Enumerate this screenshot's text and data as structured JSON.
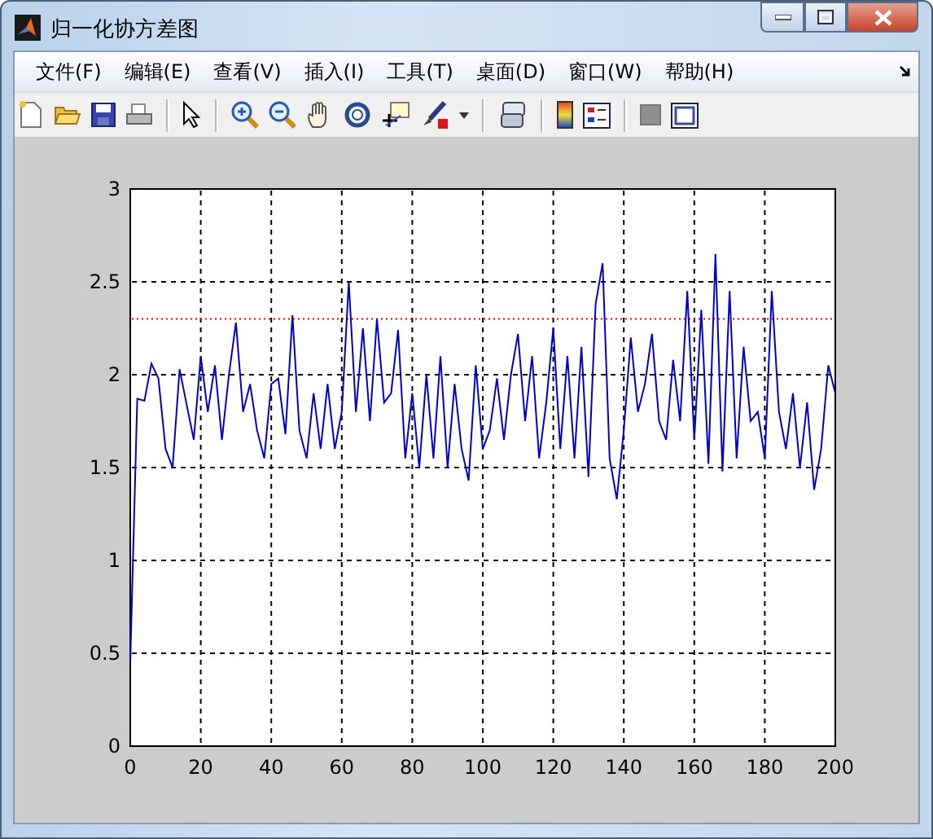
{
  "window": {
    "title": "归一化协方差图"
  },
  "menu": [
    "文件(F)",
    "编辑(E)",
    "查看(V)",
    "插入(I)",
    "工具(T)",
    "桌面(D)",
    "窗口(W)",
    "帮助(H)"
  ],
  "figure": {
    "chart_data": {
      "type": "line",
      "grid": true,
      "xlim": [
        0,
        200
      ],
      "ylim": [
        0,
        3
      ],
      "xticks": [
        0,
        20,
        40,
        60,
        80,
        100,
        120,
        140,
        160,
        180,
        200
      ],
      "yticks": [
        0,
        0.5,
        1,
        1.5,
        2,
        2.5,
        3
      ],
      "x": [
        0,
        2,
        4,
        6,
        8,
        10,
        12,
        14,
        16,
        18,
        20,
        22,
        24,
        26,
        28,
        30,
        32,
        34,
        36,
        38,
        40,
        42,
        44,
        46,
        48,
        50,
        52,
        54,
        56,
        58,
        60,
        62,
        64,
        66,
        68,
        70,
        72,
        74,
        76,
        78,
        80,
        82,
        84,
        86,
        88,
        90,
        92,
        94,
        96,
        98,
        100,
        102,
        104,
        106,
        108,
        110,
        112,
        114,
        116,
        118,
        120,
        122,
        124,
        126,
        128,
        130,
        132,
        134,
        136,
        138,
        140,
        142,
        144,
        146,
        148,
        150,
        152,
        154,
        156,
        158,
        160,
        162,
        164,
        166,
        168,
        170,
        172,
        174,
        176,
        178,
        180,
        182,
        184,
        186,
        188,
        190,
        192,
        194,
        196,
        198,
        200
      ],
      "series": [
        {
          "color": "#0000c8",
          "line_style": "solid",
          "values": [
            0.45,
            1.87,
            1.86,
            2.06,
            1.98,
            1.6,
            1.5,
            2.03,
            1.84,
            1.65,
            2.1,
            1.8,
            2.05,
            1.65,
            2.0,
            2.28,
            1.8,
            1.95,
            1.7,
            1.55,
            1.95,
            1.98,
            1.68,
            2.32,
            1.7,
            1.55,
            1.9,
            1.6,
            1.95,
            1.6,
            1.8,
            2.5,
            1.8,
            2.25,
            1.75,
            2.3,
            1.85,
            1.9,
            2.24,
            1.55,
            1.9,
            1.5,
            2.0,
            1.55,
            2.1,
            1.5,
            1.95,
            1.6,
            1.43,
            2.05,
            1.6,
            1.7,
            1.98,
            1.65,
            2.0,
            2.22,
            1.75,
            2.1,
            1.55,
            1.85,
            2.25,
            1.6,
            2.1,
            1.55,
            2.15,
            1.45,
            2.38,
            2.6,
            1.55,
            1.33,
            1.7,
            2.2,
            1.8,
            1.95,
            2.22,
            1.75,
            1.65,
            2.08,
            1.75,
            2.45,
            1.65,
            2.35,
            1.52,
            2.65,
            1.48,
            2.45,
            1.55,
            2.15,
            1.75,
            1.8,
            1.55,
            2.45,
            1.8,
            1.6,
            1.9,
            1.5,
            1.85,
            1.38,
            1.6,
            2.05,
            1.9
          ]
        }
      ],
      "ref_lines": [
        {
          "axis": "y",
          "value": 2.3,
          "color": "#ff0000",
          "line_style": "dotted"
        }
      ]
    }
  }
}
